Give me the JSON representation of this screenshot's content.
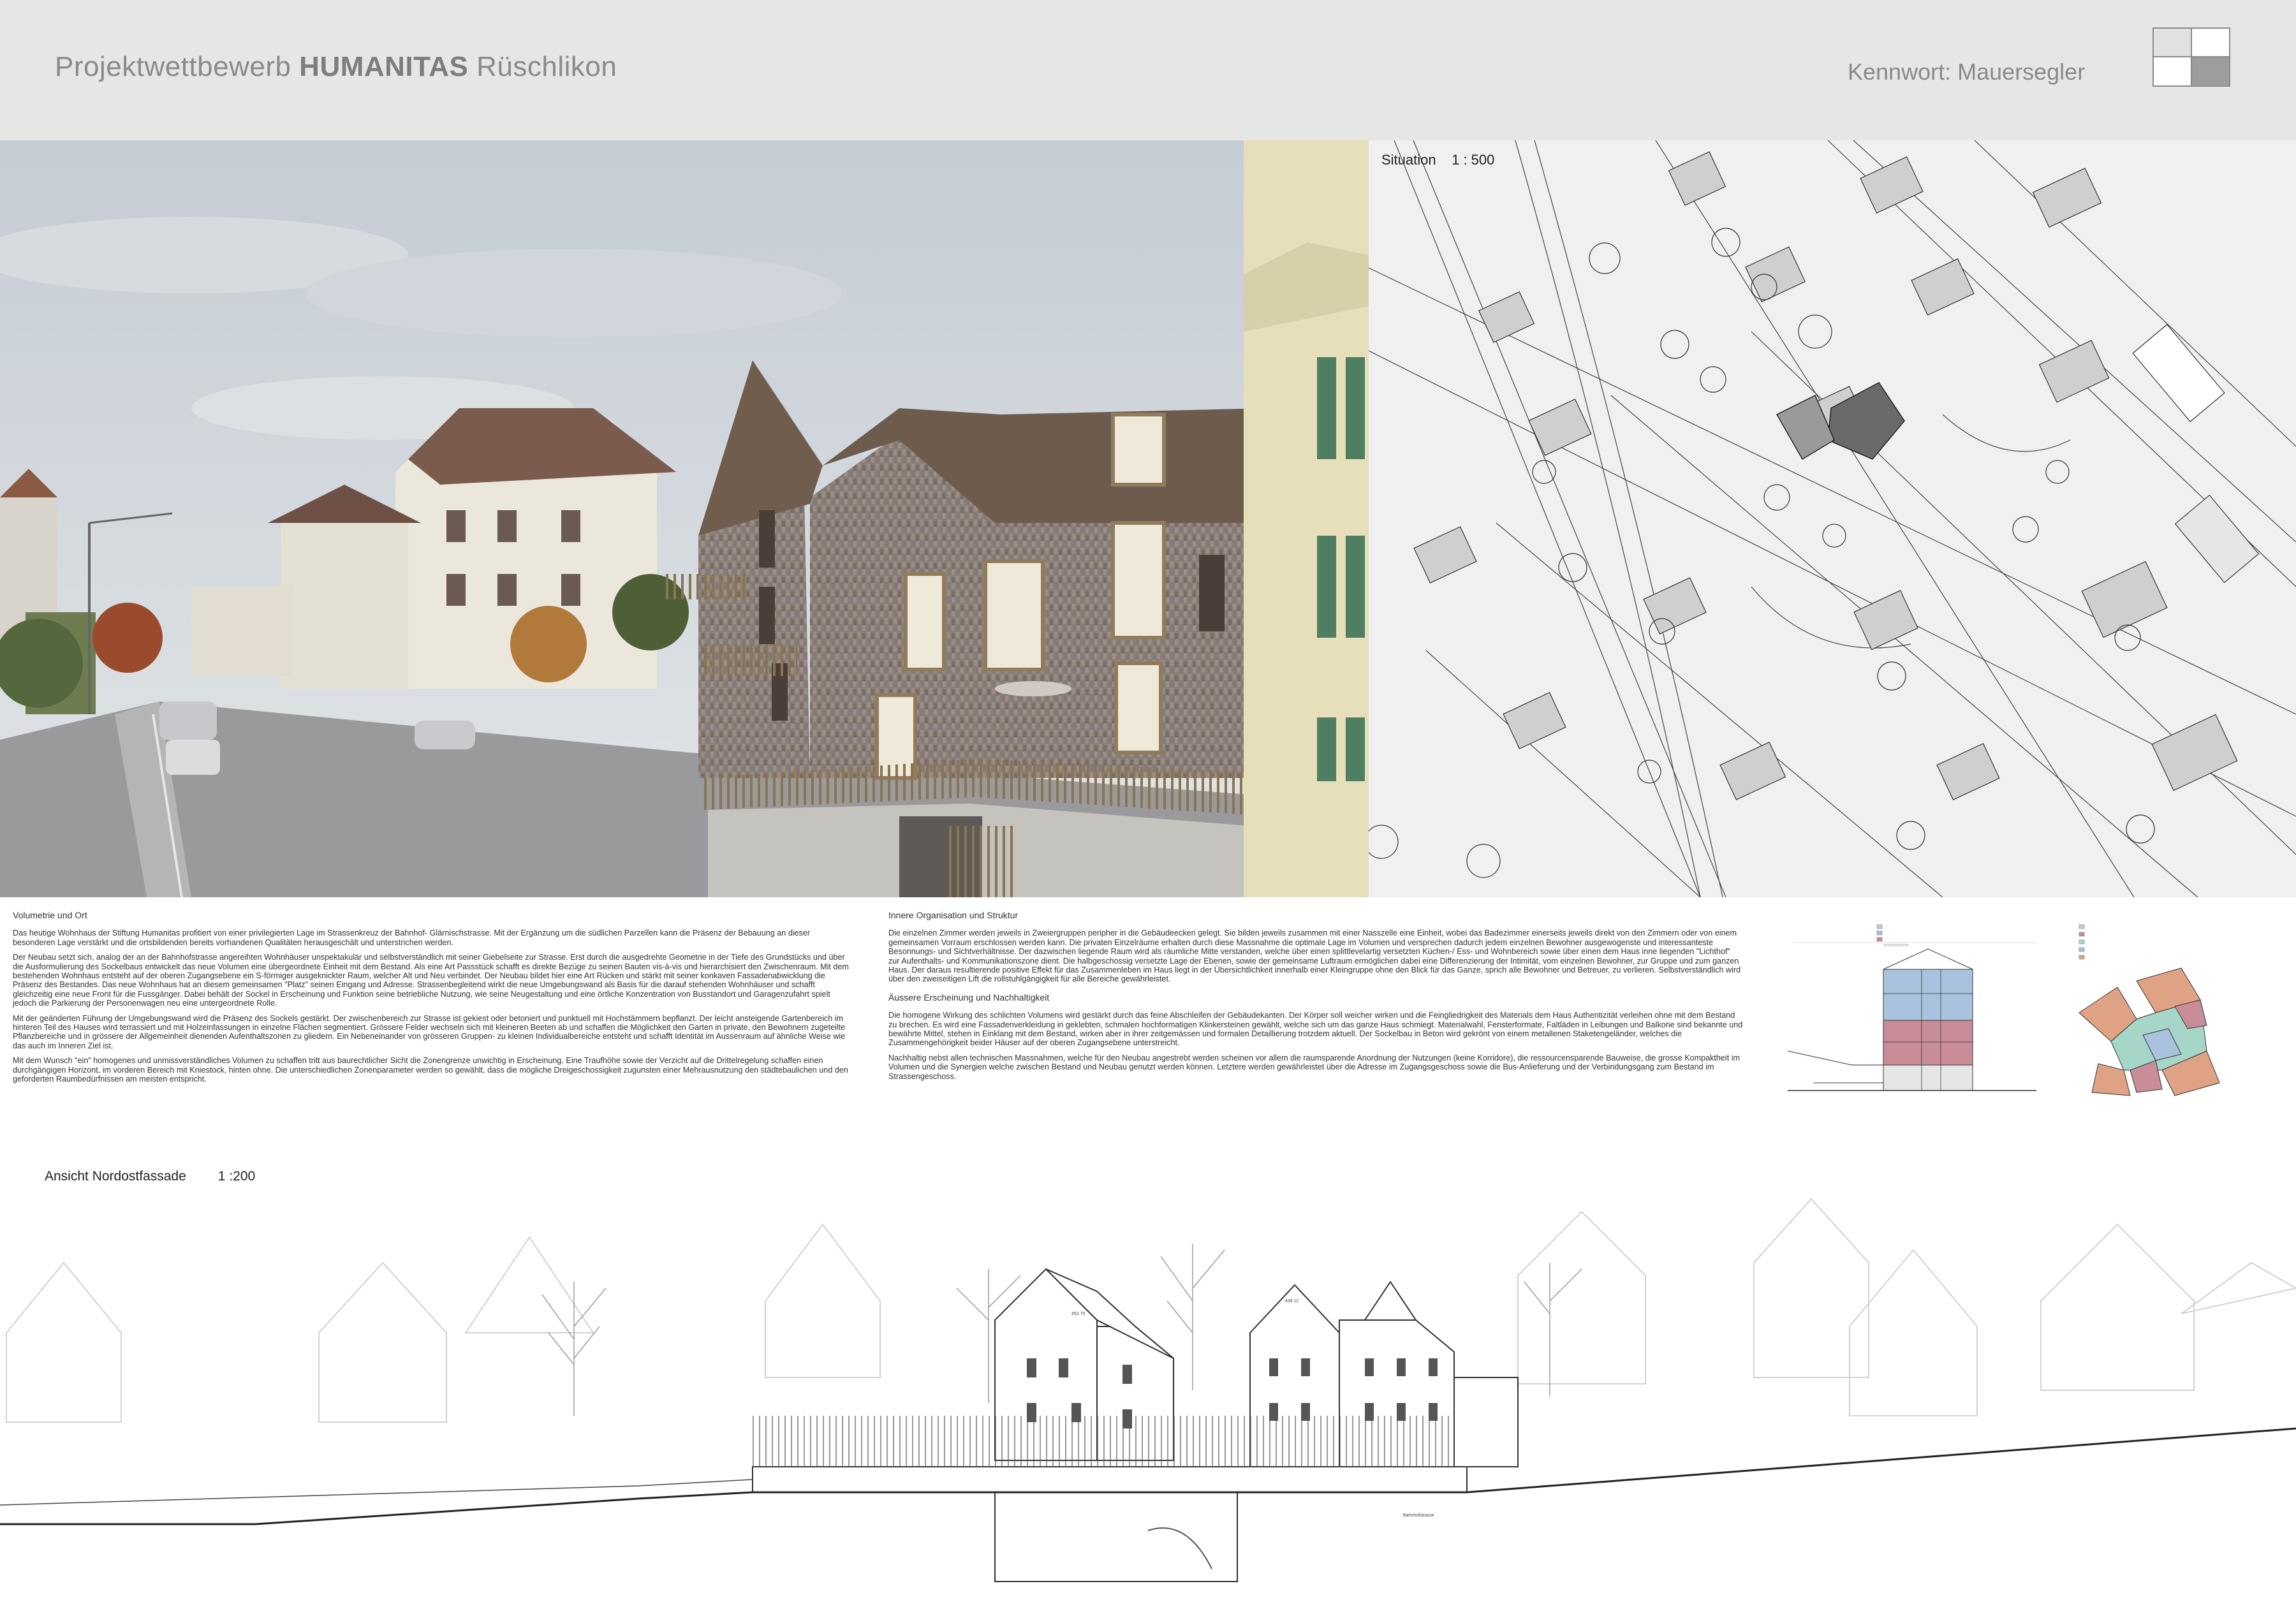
{
  "header": {
    "title_prefix": "Projektwettbewerb ",
    "title_bold": "HUMANITAS",
    "title_suffix": " Rüschlikon",
    "kennwort": "Kennwort: Mauersegler"
  },
  "site_plan": {
    "label": "Situation",
    "scale": "1 : 500"
  },
  "text_left": {
    "heading": "Volumetrie und Ort",
    "paragraphs": [
      "Das heutige Wohnhaus der Stiftung Humanitas profitiert von einer privilegierten Lage im Strassenkreuz der Bahnhof- Glärnischstrasse. Mit der Ergänzung um die südlichen Parzellen kann die Präsenz der Bebauung an dieser besonderen Lage verstärkt und die ortsbildenden bereits vorhandenen Qualitäten herausgeschält und unterstrichen werden.",
      "Der Neubau setzt sich, analog der an der Bahnhofstrasse angereihten Wohnhäuser unspektakulär und selbstverständlich mit seiner Giebelseite zur Strasse. Erst durch die ausgedrehte Geometrie in der Tiefe des Grundstücks und über die Ausformulierung des Sockelbaus entwickelt das neue Volumen eine übergeordnete Einheit mit dem Bestand. Als eine Art Passstück schafft es direkte Bezüge zu seinen Bauten vis-à-vis und hierarchisiert den Zwischenraum. Mit dem bestehenden Wohnhaus entsteht auf der oberen Zugangsebene ein S-förmiger ausgeknickter Raum, welcher Alt und Neu verbindet. Der Neubau bildet hier eine Art Rücken und stärkt mit seiner konkaven Fassadenabwicklung die Präsenz des Bestandes. Das neue Wohnhaus hat an diesem gemeinsamen \"Platz\" seinen Eingang und Adresse. Strassenbegleitend wirkt die neue Umgebungswand als Basis für die darauf stehenden Wohnhäuser und schafft gleichzeitig eine neue Front für die Fussgänger. Dabei behält der Sockel in Erscheinung und Funktion seine betriebliche Nutzung, wie seine Neugestaltung und eine örtliche Konzentration von Busstandort und Garagenzufahrt spielt jedoch die Parkierung der Personenwagen neu eine untergeordnete Rolle.",
      "Mit der geänderten Führung der Umgebungswand wird die Präsenz des Sockels gestärkt. Der zwischenbereich zur Strasse ist gekiest oder betoniert und punktuell mit Hochstämmern bepflanzt. Der leicht ansteigende Gartenbereich im hinteren Teil des Hauses wird terrassiert und mit Holzeinfassungen in einzelne Flächen segmentiert. Grössere Felder wechseln sich mit kleineren Beeten ab und schaffen die Möglichkeit den Garten in private, den Bewohnern zugeteilte Pflanzbereiche und in grössere der Allgemeinheit dienenden Aufenthaltszonen zu gliedern. Ein Nebeneinander von grösseren Gruppen- zu kleinen Individualbereiche entsteht und schafft Identität im Aussenraum auf ähnliche Weise wie das auch im Inneren Ziel ist.",
      "Mit dem Wunsch \"ein\" homogenes und unmissverständliches Volumen zu schaffen tritt aus baurechtlicher Sicht die Zonengrenze unwichtig in Erscheinung. Eine Traufhöhe sowie der Verzicht auf die Drittelregelung schaffen einen durchgängigen Horizont, im vorderen Bereich mit Kniestock, hinten ohne. Die unterschiedlichen Zonenparameter werden so gewählt, dass die mögliche Dreigeschossigkeit zugunsten einer Mehrausnutzung den städtebaulichen und den geforderten Raumbedürfnissen am meisten entspricht."
    ]
  },
  "text_right": {
    "heading1": "Innere Organisation und Struktur",
    "para1": "Die einzelnen Zimmer werden jeweils in Zweiergruppen peripher in die Gebäudeecken gelegt. Sie bilden jeweils zusammen mit einer Nasszelle eine Einheit, wobei das Badezimmer einerseits jeweils direkt von den Zimmern oder von einem gemeinsamen Vorraum erschlossen werden kann. Die privaten Einzelräume erhalten durch diese Massnahme die optimale Lage im Volumen und versprechen dadurch jedem einzelnen Bewohner ausgewogenste und interessanteste Besonnungs- und Sichtverhältnisse. Der dazwischen liegende Raum wird als räumliche Mitte verstanden, welche über einen splittlevelartig versetzten Küchen-/ Ess- und Wohnbereich sowie über einen dem Haus inne liegenden \"Lichthof\" zur Aufenthalts- und Kommunikationszone dient. Die halbgeschossig versetzte Lage der Ebenen, sowie der gemeinsame Luftraum ermöglichen dabei eine Differenzierung der Intimität, vom einzelnen Bewohner, zur Gruppe und zum ganzen Haus. Der daraus resultierende positive Effekt für das Zusammenleben im Haus liegt in der Übersichtlichkeit innerhalb einer Kleingruppe ohne den Blick für das Ganze, sprich alle Bewohner und Betreuer, zu verlieren. Selbstverständlich wird über den zweiseitigen Lift die rollstuhlgängigkeit für alle Bereiche gewährleistet.",
    "heading2": "Äussere Erscheinung und Nachhaltigkeit",
    "para2": "Die homogene Wirkung des schlichten Volumens wird gestärkt durch das feine Abschleifen der Gebäudekanten. Der Körper soll weicher wirken und die Feingliedrigkeit des Materials dem Haus Authentizität verleihen ohne mit dem Bestand zu brechen. Es wird eine Fassadenverkleidung in geklebten, schmalen hochformatigen Klinkersteinen gewählt, welche sich um das ganze Haus schmiegt. Materialwahl, Fensterformate, Faltläden in Leibungen und Balkone sind bekannte und bewährte Mittel, stehen in Einklang mit dem Bestand, wirken aber in ihrer zeitgemässen und formalen Detaillierung trotzdem aktuell. Der Sockelbau in Beton wird gekrönt von einem metallenen Staketengeländer, welches die Zusammengehörigkeit beider Häuser auf der oberen Zugangsebene unterstreicht.",
    "para3": "Nachhaltig nebst allen technischen Massnahmen, welche für den Neubau angestrebt werden scheinen vor allem die raumsparende Anordnung der Nutzungen (keine Korridore), die ressourcensparende Bauweise, die grosse Kompaktheit im Volumen und die Synergien welche zwischen Bestand und Neubau genutzt werden können. Letztere werden gewährleistet über die Adresse im Zugangsgeschoss sowie die Bus-Anlieferung und der Verbindungsgang zum Bestand im Strassengeschoss."
  },
  "elevation": {
    "label": "Ansicht Nordostfassade",
    "scale": "1 :200",
    "height_1": "452.70",
    "height_2": "434.11",
    "street": "Bahnhofstrasse"
  },
  "colors": {
    "header_bg": "#e6e6e4",
    "facade": "#8a8079",
    "roof": "#6d5b4d",
    "shutters": "#4f7f63",
    "diagram_blue": "#a9c3de",
    "diagram_red": "#c98d98",
    "diagram_green": "#a6d6c8",
    "diagram_orange": "#e0a284"
  }
}
